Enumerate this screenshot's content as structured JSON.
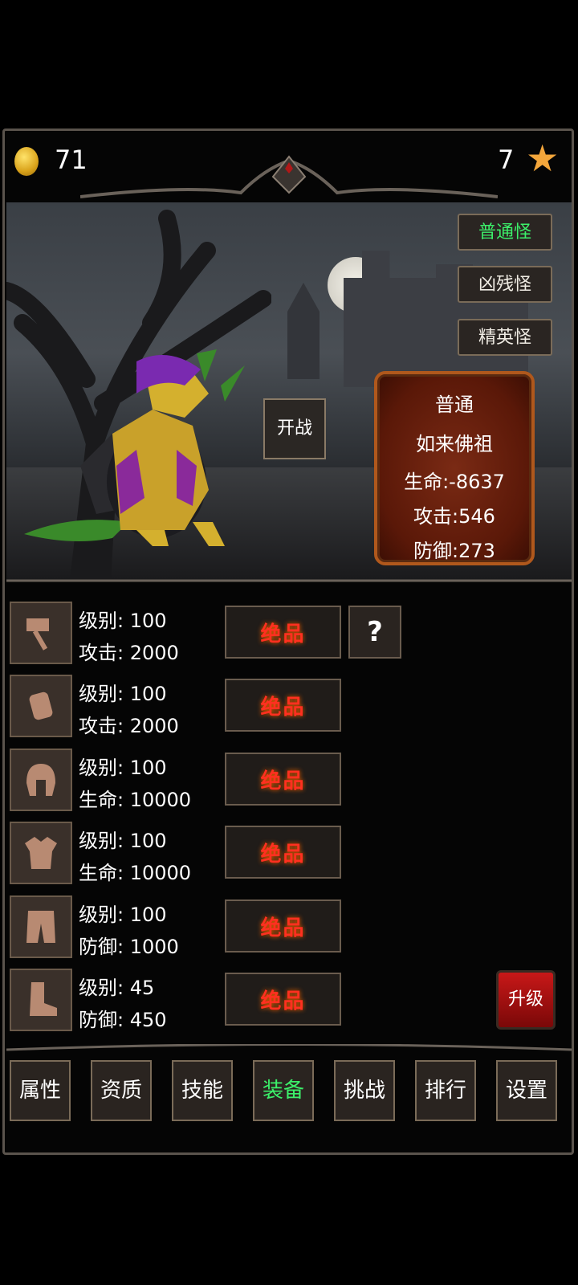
{
  "header": {
    "coins": "71",
    "stars": "7"
  },
  "monster_tabs": [
    "普通怪",
    "凶残怪",
    "精英怪"
  ],
  "active_monster_tab": 0,
  "fight_label": "开战",
  "enemy": {
    "tier": "普通",
    "name": "如来佛祖",
    "hp": "生命:-8637",
    "atk": "攻击:546",
    "def": "防御:273"
  },
  "equipment": [
    {
      "icon": "hammer-icon",
      "level": "级别: 100",
      "stat": "攻击: 2000",
      "grade": "绝品"
    },
    {
      "icon": "bracer-icon",
      "level": "级别: 100",
      "stat": "攻击: 2000",
      "grade": "绝品"
    },
    {
      "icon": "helmet-icon",
      "level": "级别: 100",
      "stat": "生命: 10000",
      "grade": "绝品"
    },
    {
      "icon": "armor-icon",
      "level": "级别: 100",
      "stat": "生命: 10000",
      "grade": "绝品"
    },
    {
      "icon": "pants-icon",
      "level": "级别: 100",
      "stat": "防御: 1000",
      "grade": "绝品"
    },
    {
      "icon": "boots-icon",
      "level": "级别: 45",
      "stat": "防御: 450",
      "grade": "绝品"
    }
  ],
  "help_label": "?",
  "upgrade_label": "升级",
  "nav": [
    "属性",
    "资质",
    "技能",
    "装备",
    "挑战",
    "排行",
    "设置"
  ],
  "active_nav": 3,
  "colors": {
    "active": "#3cf06a",
    "grade": "#ff3020",
    "star": "#f3a63b"
  }
}
